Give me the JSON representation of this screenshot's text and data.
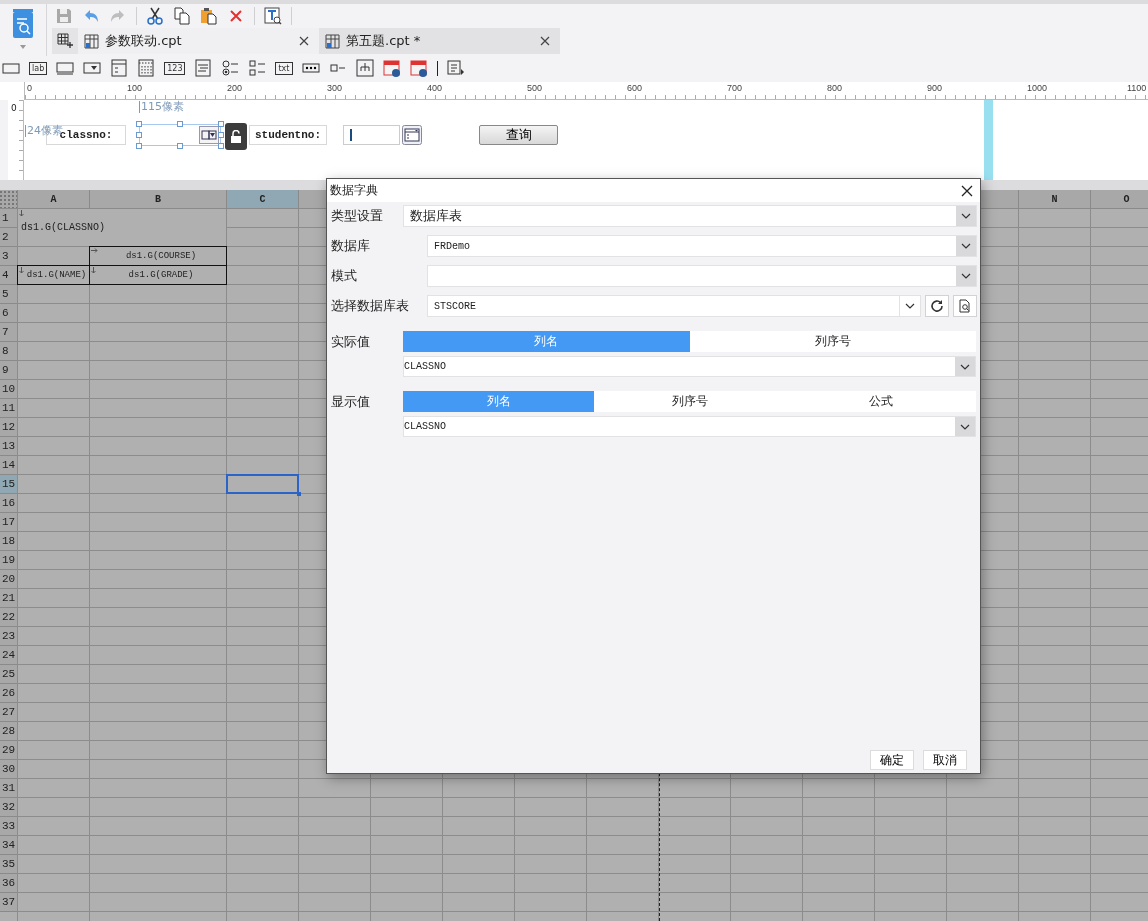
{
  "tabs": [
    {
      "label": "参数联动.cpt",
      "selected": true
    },
    {
      "label": "第五题.cpt *",
      "selected": false
    }
  ],
  "palette": [
    {
      "kind": "textbox"
    },
    {
      "kind": "label",
      "text": "lab"
    },
    {
      "kind": "input"
    },
    {
      "kind": "combo"
    },
    {
      "kind": "window"
    },
    {
      "kind": "calendar"
    },
    {
      "kind": "number",
      "text": "123"
    },
    {
      "kind": "textarea"
    },
    {
      "kind": "radio"
    },
    {
      "kind": "checklist"
    },
    {
      "kind": "text",
      "text": "txt"
    },
    {
      "kind": "password"
    },
    {
      "kind": "checkbox"
    },
    {
      "kind": "tree"
    },
    {
      "kind": "date"
    },
    {
      "kind": "date"
    },
    {
      "kind": "separator"
    },
    {
      "kind": "more"
    }
  ],
  "ruler": [
    "0",
    "100",
    "200",
    "300",
    "400",
    "500",
    "600",
    "700",
    "800",
    "900",
    "1000",
    "1100"
  ],
  "vertical_ruler": "0",
  "form": {
    "width_hint": "115像素",
    "height_hint": "24像素",
    "widgets": [
      {
        "kind": "label",
        "text": "classno:"
      },
      {
        "kind": "combo",
        "selected": true
      },
      {
        "kind": "lock"
      },
      {
        "kind": "label",
        "text": "studentno:"
      },
      {
        "kind": "date"
      },
      {
        "kind": "button",
        "text": "查询"
      }
    ]
  },
  "sheet": {
    "columns_left": [
      {
        "label": "A",
        "selected": false
      },
      {
        "label": "B",
        "selected": false
      },
      {
        "label": "C",
        "selected": true
      }
    ],
    "columns_right": [
      {
        "label": "N",
        "selected": false
      },
      {
        "label": "O",
        "selected": false
      }
    ],
    "rows": [
      {
        "label": "1",
        "selected": false
      },
      {
        "label": "2",
        "selected": false
      },
      {
        "label": "3",
        "selected": false
      },
      {
        "label": "4",
        "selected": false
      },
      {
        "label": "5",
        "selected": false
      },
      {
        "label": "6",
        "selected": false
      },
      {
        "label": "7",
        "selected": false
      },
      {
        "label": "8",
        "selected": false
      },
      {
        "label": "9",
        "selected": false
      },
      {
        "label": "10",
        "selected": false
      },
      {
        "label": "11",
        "selected": false
      },
      {
        "label": "12",
        "selected": false
      },
      {
        "label": "13",
        "selected": false
      },
      {
        "label": "14",
        "selected": false
      },
      {
        "label": "15",
        "selected": true
      },
      {
        "label": "16",
        "selected": false
      },
      {
        "label": "17",
        "selected": false
      },
      {
        "label": "18",
        "selected": false
      },
      {
        "label": "19",
        "selected": false
      },
      {
        "label": "20",
        "selected": false
      },
      {
        "label": "21",
        "selected": false
      },
      {
        "label": "22",
        "selected": false
      },
      {
        "label": "23",
        "selected": false
      },
      {
        "label": "24",
        "selected": false
      },
      {
        "label": "25",
        "selected": false
      },
      {
        "label": "26",
        "selected": false
      },
      {
        "label": "27",
        "selected": false
      },
      {
        "label": "28",
        "selected": false
      },
      {
        "label": "29",
        "selected": false
      },
      {
        "label": "30",
        "selected": false
      },
      {
        "label": "31",
        "selected": false
      },
      {
        "label": "32",
        "selected": false
      },
      {
        "label": "33",
        "selected": false
      },
      {
        "label": "34",
        "selected": false
      },
      {
        "label": "35",
        "selected": false
      },
      {
        "label": "36",
        "selected": false
      },
      {
        "label": "37",
        "selected": false
      }
    ],
    "cells": [
      {
        "text": "ds1.G(CLASSNO)",
        "kind": "down-expand",
        "bordered": false
      },
      {
        "text": "ds1.G(COURSE)",
        "kind": "right-expand",
        "bordered": true
      },
      {
        "text": "ds1.G(NAME)",
        "kind": "down-expand",
        "bordered": true
      },
      {
        "text": "ds1.G(GRADE)",
        "kind": "down-expand",
        "bordered": true
      }
    ]
  },
  "dialog": {
    "title": "数据字典",
    "fields": [
      {
        "label": "类型设置",
        "value": "数据库表",
        "kind": "select"
      },
      {
        "label": "数据库",
        "value": "FRDemo",
        "kind": "select"
      },
      {
        "label": "模式",
        "kind": "select"
      },
      {
        "label": "选择数据库表",
        "value": "STSCORE",
        "kind": "table-picker"
      }
    ],
    "groups": [
      {
        "label": "实际值",
        "options": [
          {
            "label": "列名",
            "selected": true
          },
          {
            "label": "列序号",
            "selected": false
          }
        ],
        "value": "CLASSNO"
      },
      {
        "label": "显示值",
        "options": [
          {
            "label": "列名",
            "selected": true
          },
          {
            "label": "列序号",
            "selected": false
          },
          {
            "label": "公式",
            "selected": false
          }
        ],
        "value": "CLASSNO"
      }
    ],
    "buttons": [
      "确定",
      "取消"
    ]
  }
}
